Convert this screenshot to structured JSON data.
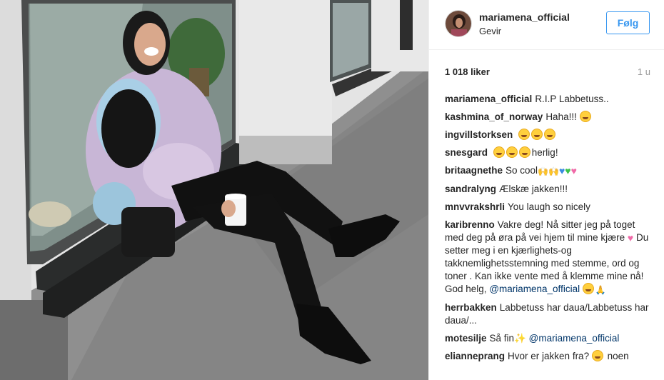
{
  "post": {
    "username": "mariamena_official",
    "location": "Gevir",
    "follow_label": "Følg",
    "likes": "1 018 liker",
    "time_ago": "1 u"
  },
  "comments": [
    {
      "user": "mariamena_official",
      "text": "R.I.P Labbetuss..",
      "mention": "",
      "tail": "",
      "emoji": []
    },
    {
      "user": "kashmina_of_norway",
      "text": "Haha!!!",
      "mention": "",
      "tail": "",
      "emoji": [
        "laughing-crying-emoji"
      ]
    },
    {
      "user": "ingvillstorksen",
      "text": "",
      "mention": "",
      "tail": "",
      "emoji": [
        "laughing-crying-emoji",
        "laughing-crying-emoji",
        "laughing-crying-emoji"
      ]
    },
    {
      "user": "snesgard",
      "text": "",
      "mention": "",
      "tail": "herlig!",
      "emoji": [
        "laughing-crying-emoji",
        "laughing-crying-emoji",
        "laughing-crying-emoji"
      ]
    },
    {
      "user": "britaagnethe",
      "text": "So cool",
      "mention": "",
      "tail": "",
      "emoji": [
        "raised-hands-emoji",
        "raised-hands-emoji",
        "blue-heart-emoji",
        "green-heart-emoji",
        "sparkling-heart-emoji"
      ]
    },
    {
      "user": "sandralyng",
      "text": "Ælskæ jakken!!!",
      "mention": "",
      "tail": "",
      "emoji": []
    },
    {
      "user": "mnvvrakshrli",
      "text": "You laugh so nicely",
      "mention": "",
      "tail": "",
      "emoji": []
    },
    {
      "user": "karibrenno",
      "text": "Vakre deg! Nå sitter jeg på toget med deg på øra på vei hjem til mine kjære",
      "text2": "Du setter meg i en kjærlighets-og takknemlighetsstemning med stemme, ord og toner . Kan ikke vente med å klemme mine nå! God helg,",
      "mention": "@mariamena_official",
      "tail": "",
      "emoji": [
        "sparkling-heart-emoji"
      ],
      "emoji_end": [
        "kiss-emoji",
        "praying-hands-emoji"
      ]
    },
    {
      "user": "herrbakken",
      "text": "Labbetuss har daua/Labbetuss har daua/...",
      "mention": "",
      "tail": "",
      "emoji": []
    },
    {
      "user": "motesilje",
      "text": "Så fin",
      "mention": "@mariamena_official",
      "tail": "",
      "emoji": [
        "sparkles-emoji"
      ]
    },
    {
      "user": "elianneprang",
      "text": "Hvor er jakken fra?",
      "mention": "",
      "tail": "noen",
      "emoji": [
        "heart-eyes-cat-emoji"
      ]
    }
  ],
  "colors": {
    "accent": "#3897f0",
    "mention": "#003569",
    "muted": "#999999",
    "border": "#efefef"
  },
  "icons": {
    "avatar": "profile-photo-avatar"
  }
}
